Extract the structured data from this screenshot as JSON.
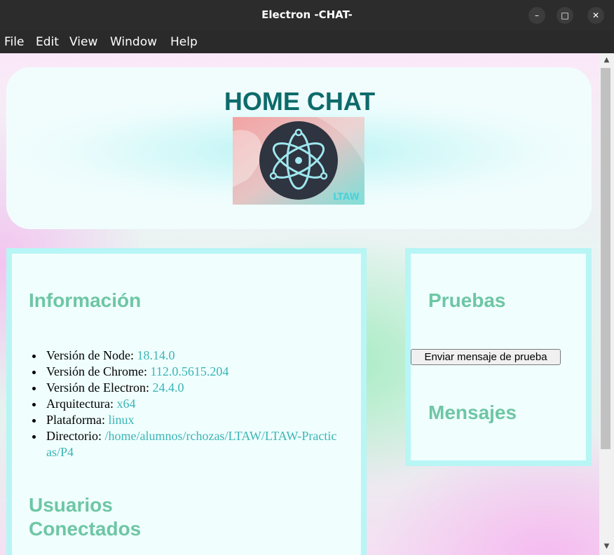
{
  "window": {
    "title": "Electron -CHAT-",
    "controls": [
      "minimize-icon",
      "maximize-icon",
      "close-icon"
    ]
  },
  "menubar": {
    "items": [
      "File",
      "Edit",
      "View",
      "Window",
      "Help"
    ]
  },
  "header": {
    "title": "HOME CHAT",
    "logo_text": "LTAW"
  },
  "info": {
    "heading": "Información",
    "items": [
      {
        "label": "Versión de Node: ",
        "value": "18.14.0"
      },
      {
        "label": "Versión de Chrome: ",
        "value": "112.0.5615.204"
      },
      {
        "label": "Versión de Electron: ",
        "value": "24.4.0"
      },
      {
        "label": "Arquitectura: ",
        "value": "x64"
      },
      {
        "label": "Plataforma: ",
        "value": "linux"
      },
      {
        "label": "Directorio: ",
        "value": "/home/alumnos/rchozas/LTAW/LTAW-Practicas/P4"
      }
    ],
    "users_heading_line1": "Usuarios",
    "users_heading_line2": "Conectados"
  },
  "tests": {
    "heading": "Pruebas",
    "button_label": "Enviar mensaje de prueba",
    "messages_heading": "Mensajes"
  },
  "colors": {
    "accent_value": "#3ab5b5",
    "heading": "#6ec6a4",
    "title": "#0d6b6b",
    "panel_border": "#b8f5f5"
  }
}
